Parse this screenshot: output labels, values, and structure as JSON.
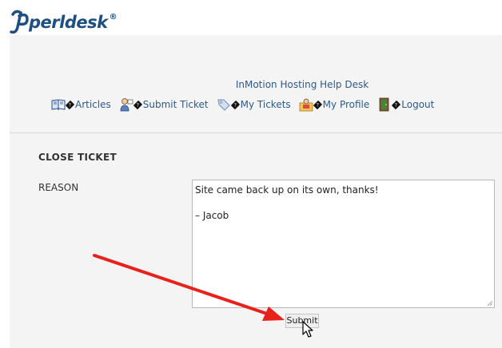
{
  "logo": {
    "text": "perldesk",
    "trademark": "®"
  },
  "header": {
    "desk_title": "InMotion Hosting Help Desk"
  },
  "nav": {
    "items": [
      {
        "label": "Articles",
        "icon": "book-icon"
      },
      {
        "label": "Submit Ticket",
        "icon": "user-submit-icon"
      },
      {
        "label": "My Tickets",
        "icon": "tag-icon"
      },
      {
        "label": "My Profile",
        "icon": "profile-folder-icon"
      },
      {
        "label": "Logout",
        "icon": "logout-door-icon"
      }
    ],
    "broken_char": "?"
  },
  "form": {
    "section_title": "CLOSE TICKET",
    "reason_label": "REASON",
    "reason_lines": [
      "Site came back up on its own, thanks!",
      "",
      "– Jacob"
    ],
    "submit_label": "Submit"
  },
  "colors": {
    "link": "#2e5a8a",
    "arrow": "#e8221b",
    "brand": "#1d4f82"
  }
}
